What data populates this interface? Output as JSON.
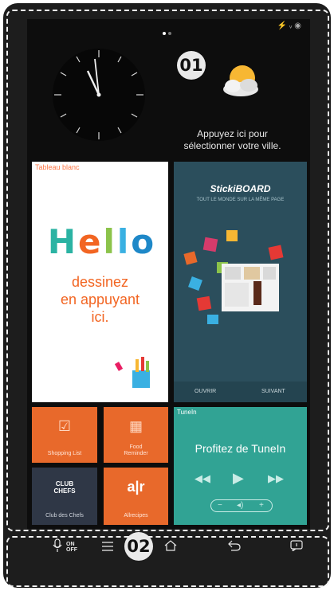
{
  "clock": {
    "time": "11:58"
  },
  "callouts": {
    "top": "01",
    "bottom": "02"
  },
  "weather": {
    "icon": "sun-cloud-icon",
    "line1": "Appuyez ici pour",
    "line2": "sélectionner votre ville."
  },
  "tiles": {
    "hello": {
      "label": "Tableau blanc",
      "word": "Hello",
      "line1": "dessinez",
      "line2": "en appuyant",
      "line3": "ici."
    },
    "sticki": {
      "title": "StickiBOARD",
      "subtitle": "TOUT LE MONDE SUR LA MÊME PAGE",
      "tab_left": "OUVRIR",
      "tab_right": "SUIVANT"
    },
    "shopping": {
      "name": "Shopping List"
    },
    "food": {
      "name_line1": "Food",
      "name_line2": "Reminder"
    },
    "club": {
      "logo_line1": "CLUB",
      "logo_line2": "CHEFS",
      "name": "Club des Chefs"
    },
    "allrecipes": {
      "logo": "a|r",
      "name": "Allrecipes"
    },
    "tunein": {
      "label": "TuneIn",
      "title": "Profitez de TuneIn"
    }
  },
  "navbar": {
    "mic_on": "ON",
    "mic_off": "OFF",
    "icons": [
      "microphone-icon",
      "menu-icon",
      "home-icon",
      "back-icon",
      "recent-icon"
    ]
  },
  "colors": {
    "frame": "#1d1d1d",
    "orange": "#e8692b",
    "teal": "#31a394",
    "navy": "#2f3746",
    "sticki_blue": "#2b4e5c"
  }
}
